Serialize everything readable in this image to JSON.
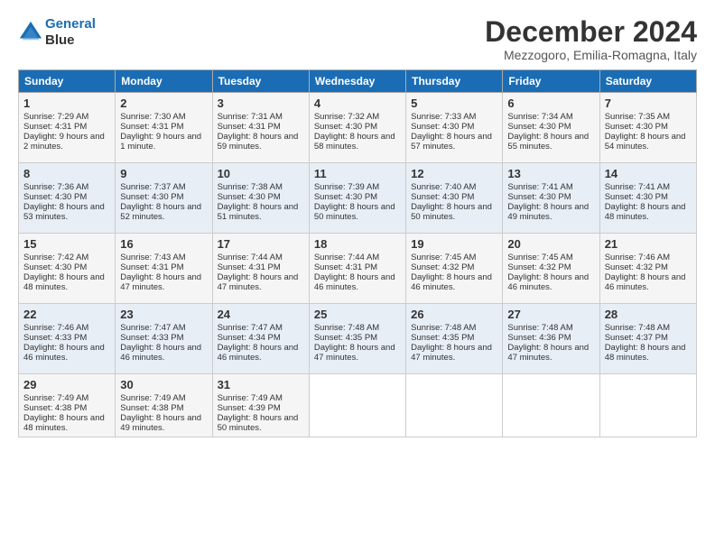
{
  "logo": {
    "line1": "General",
    "line2": "Blue"
  },
  "title": "December 2024",
  "subtitle": "Mezzogoro, Emilia-Romagna, Italy",
  "headers": [
    "Sunday",
    "Monday",
    "Tuesday",
    "Wednesday",
    "Thursday",
    "Friday",
    "Saturday"
  ],
  "weeks": [
    [
      {
        "day": "1",
        "sunrise": "7:29 AM",
        "sunset": "4:31 PM",
        "daylight": "9 hours and 2 minutes."
      },
      {
        "day": "2",
        "sunrise": "7:30 AM",
        "sunset": "4:31 PM",
        "daylight": "9 hours and 1 minute."
      },
      {
        "day": "3",
        "sunrise": "7:31 AM",
        "sunset": "4:31 PM",
        "daylight": "8 hours and 59 minutes."
      },
      {
        "day": "4",
        "sunrise": "7:32 AM",
        "sunset": "4:30 PM",
        "daylight": "8 hours and 58 minutes."
      },
      {
        "day": "5",
        "sunrise": "7:33 AM",
        "sunset": "4:30 PM",
        "daylight": "8 hours and 57 minutes."
      },
      {
        "day": "6",
        "sunrise": "7:34 AM",
        "sunset": "4:30 PM",
        "daylight": "8 hours and 55 minutes."
      },
      {
        "day": "7",
        "sunrise": "7:35 AM",
        "sunset": "4:30 PM",
        "daylight": "8 hours and 54 minutes."
      }
    ],
    [
      {
        "day": "8",
        "sunrise": "7:36 AM",
        "sunset": "4:30 PM",
        "daylight": "8 hours and 53 minutes."
      },
      {
        "day": "9",
        "sunrise": "7:37 AM",
        "sunset": "4:30 PM",
        "daylight": "8 hours and 52 minutes."
      },
      {
        "day": "10",
        "sunrise": "7:38 AM",
        "sunset": "4:30 PM",
        "daylight": "8 hours and 51 minutes."
      },
      {
        "day": "11",
        "sunrise": "7:39 AM",
        "sunset": "4:30 PM",
        "daylight": "8 hours and 50 minutes."
      },
      {
        "day": "12",
        "sunrise": "7:40 AM",
        "sunset": "4:30 PM",
        "daylight": "8 hours and 50 minutes."
      },
      {
        "day": "13",
        "sunrise": "7:41 AM",
        "sunset": "4:30 PM",
        "daylight": "8 hours and 49 minutes."
      },
      {
        "day": "14",
        "sunrise": "7:41 AM",
        "sunset": "4:30 PM",
        "daylight": "8 hours and 48 minutes."
      }
    ],
    [
      {
        "day": "15",
        "sunrise": "7:42 AM",
        "sunset": "4:30 PM",
        "daylight": "8 hours and 48 minutes."
      },
      {
        "day": "16",
        "sunrise": "7:43 AM",
        "sunset": "4:31 PM",
        "daylight": "8 hours and 47 minutes."
      },
      {
        "day": "17",
        "sunrise": "7:44 AM",
        "sunset": "4:31 PM",
        "daylight": "8 hours and 47 minutes."
      },
      {
        "day": "18",
        "sunrise": "7:44 AM",
        "sunset": "4:31 PM",
        "daylight": "8 hours and 46 minutes."
      },
      {
        "day": "19",
        "sunrise": "7:45 AM",
        "sunset": "4:32 PM",
        "daylight": "8 hours and 46 minutes."
      },
      {
        "day": "20",
        "sunrise": "7:45 AM",
        "sunset": "4:32 PM",
        "daylight": "8 hours and 46 minutes."
      },
      {
        "day": "21",
        "sunrise": "7:46 AM",
        "sunset": "4:32 PM",
        "daylight": "8 hours and 46 minutes."
      }
    ],
    [
      {
        "day": "22",
        "sunrise": "7:46 AM",
        "sunset": "4:33 PM",
        "daylight": "8 hours and 46 minutes."
      },
      {
        "day": "23",
        "sunrise": "7:47 AM",
        "sunset": "4:33 PM",
        "daylight": "8 hours and 46 minutes."
      },
      {
        "day": "24",
        "sunrise": "7:47 AM",
        "sunset": "4:34 PM",
        "daylight": "8 hours and 46 minutes."
      },
      {
        "day": "25",
        "sunrise": "7:48 AM",
        "sunset": "4:35 PM",
        "daylight": "8 hours and 47 minutes."
      },
      {
        "day": "26",
        "sunrise": "7:48 AM",
        "sunset": "4:35 PM",
        "daylight": "8 hours and 47 minutes."
      },
      {
        "day": "27",
        "sunrise": "7:48 AM",
        "sunset": "4:36 PM",
        "daylight": "8 hours and 47 minutes."
      },
      {
        "day": "28",
        "sunrise": "7:48 AM",
        "sunset": "4:37 PM",
        "daylight": "8 hours and 48 minutes."
      }
    ],
    [
      {
        "day": "29",
        "sunrise": "7:49 AM",
        "sunset": "4:38 PM",
        "daylight": "8 hours and 48 minutes."
      },
      {
        "day": "30",
        "sunrise": "7:49 AM",
        "sunset": "4:38 PM",
        "daylight": "8 hours and 49 minutes."
      },
      {
        "day": "31",
        "sunrise": "7:49 AM",
        "sunset": "4:39 PM",
        "daylight": "8 hours and 50 minutes."
      },
      null,
      null,
      null,
      null
    ]
  ]
}
